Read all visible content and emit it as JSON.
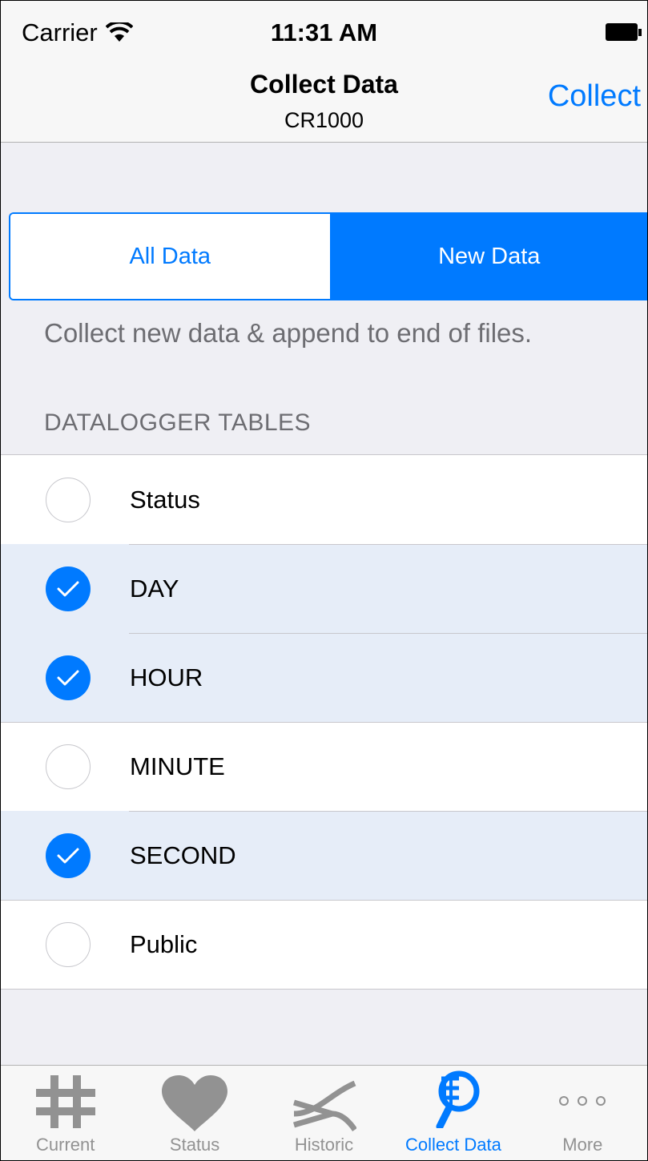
{
  "status_bar": {
    "carrier": "Carrier",
    "time": "11:31 AM"
  },
  "nav": {
    "title": "Collect Data",
    "subtitle": "CR1000",
    "action_label": "Collect"
  },
  "mode": {
    "options": [
      "All Data",
      "New Data"
    ],
    "selected": "New Data",
    "description": "Collect new data & append to end of files."
  },
  "tables": {
    "header": "DATALOGGER TABLES",
    "items": [
      {
        "label": "Status",
        "checked": false
      },
      {
        "label": "DAY",
        "checked": true
      },
      {
        "label": "HOUR",
        "checked": true
      },
      {
        "label": "MINUTE",
        "checked": false
      },
      {
        "label": "SECOND",
        "checked": true
      },
      {
        "label": "Public",
        "checked": false
      }
    ]
  },
  "tab_bar": {
    "items": [
      {
        "label": "Current",
        "icon": "hash-icon"
      },
      {
        "label": "Status",
        "icon": "heart-icon"
      },
      {
        "label": "Historic",
        "icon": "historic-icon"
      },
      {
        "label": "Collect Data",
        "icon": "collect-net-icon"
      },
      {
        "label": "More",
        "icon": "more-dots-icon"
      }
    ],
    "active": "Collect Data"
  },
  "colors": {
    "accent": "#007aff",
    "selected_row": "#e6edf8",
    "inactive_tab": "#929292"
  }
}
